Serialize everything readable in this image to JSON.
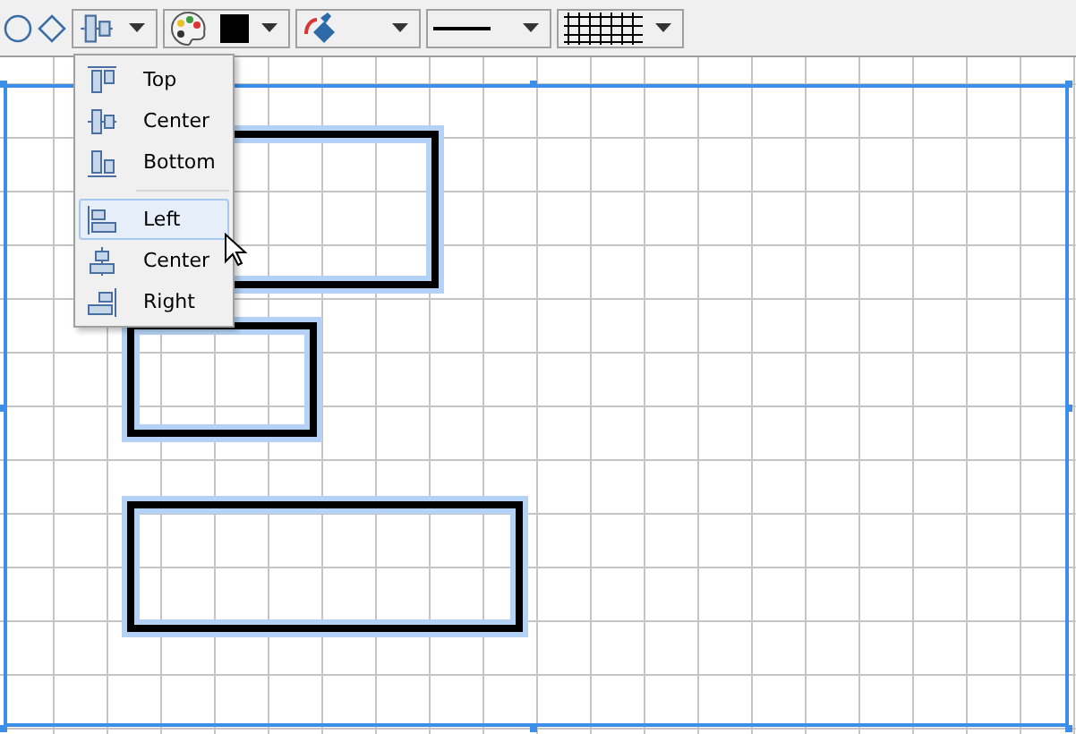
{
  "align_menu": {
    "items": [
      {
        "label": "Top",
        "kind": "top",
        "selected": false
      },
      {
        "label": "Center",
        "kind": "middle",
        "selected": false
      },
      {
        "label": "Bottom",
        "kind": "bottom",
        "selected": false
      },
      {
        "label": "Left",
        "kind": "left",
        "selected": true,
        "group_start": true
      },
      {
        "label": "Center",
        "kind": "hcenter",
        "selected": false
      },
      {
        "label": "Right",
        "kind": "right",
        "selected": false
      }
    ]
  },
  "shapes": [
    {
      "kind": "rectangle",
      "selected": true
    },
    {
      "kind": "rectangle",
      "selected": true
    },
    {
      "kind": "rectangle",
      "selected": true
    }
  ]
}
